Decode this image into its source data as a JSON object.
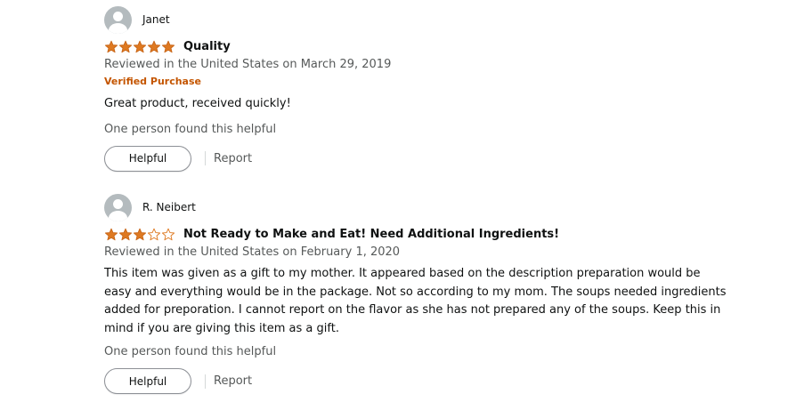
{
  "colors": {
    "star_fill": "#de7921",
    "verified": "#c45500",
    "secondary_text": "#565959"
  },
  "reviews": [
    {
      "profile_name": "Janet",
      "rating": 5,
      "title": "Quality",
      "date": "Reviewed in the United States on March 29, 2019",
      "verified": "Verified Purchase",
      "body": "Great product, received quickly!",
      "helpful_count": "One person found this helpful",
      "helpful_label": "Helpful",
      "report_label": "Report"
    },
    {
      "profile_name": "R. Neibert",
      "rating": 3,
      "title": "Not Ready to Make and Eat! Need Additional Ingredients!",
      "date": "Reviewed in the United States on February 1, 2020",
      "body": "This item was given as a gift to my mother. It appeared based on the description preparation would be easy and everything would be in the package. Not so according to my mom. The soups needed ingredients added for preporation. I cannot report on the flavor as she has not prepared any of the soups. Keep this in mind if you are giving this item as a gift.",
      "helpful_count": "One person found this helpful",
      "helpful_label": "Helpful",
      "report_label": "Report"
    }
  ]
}
